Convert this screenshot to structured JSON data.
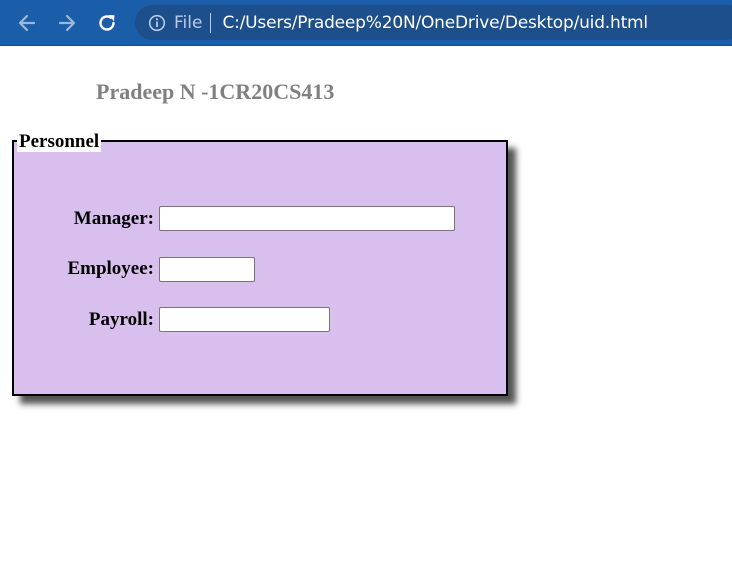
{
  "browser": {
    "scheme_label": "File",
    "url": "C:/Users/Pradeep%20N/OneDrive/Desktop/uid.html",
    "icons": [
      "back-arrow-icon",
      "forward-arrow-icon",
      "reload-icon",
      "info-icon"
    ],
    "colors": {
      "toolbar": "#1a5da8",
      "omnibox": "#1d4f8c"
    }
  },
  "page": {
    "heading": "Pradeep N -1CR20CS413",
    "fieldset": {
      "legend": "Personnel",
      "background": "#d8bfee",
      "fields": {
        "manager": {
          "label": "Manager:",
          "value": ""
        },
        "employee": {
          "label": "Employee:",
          "value": ""
        },
        "payroll": {
          "label": "Payroll:",
          "value": ""
        }
      }
    }
  }
}
